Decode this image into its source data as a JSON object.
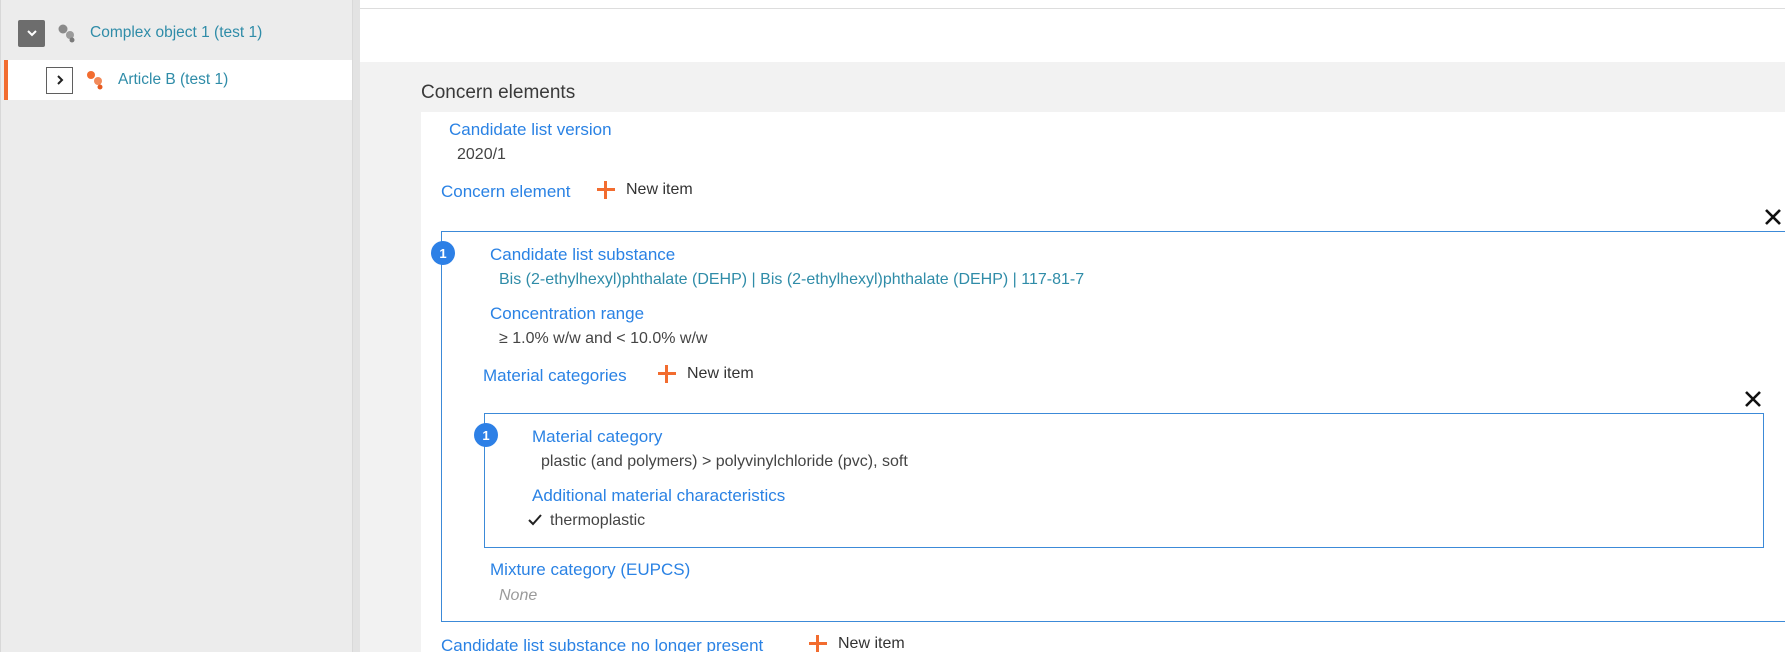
{
  "tree": {
    "root": {
      "label": "Complex object 1 (test 1)",
      "icon": "gear-cluster-icon",
      "toggle": "chevron-down-icon"
    },
    "child": {
      "label": "Article B (test 1)",
      "icon": "article-icon",
      "toggle": "chevron-right-icon"
    }
  },
  "section": {
    "title": "Concern elements"
  },
  "candidate_list_version": {
    "label": "Candidate list version",
    "value": "2020/1"
  },
  "concern_element": {
    "label": "Concern element",
    "new_item": "New item"
  },
  "concern_items": [
    {
      "index": "1",
      "candidate_substance": {
        "label": "Candidate list substance",
        "value": "Bis (2-ethylhexyl)phthalate (DEHP) | Bis (2-ethylhexyl)phthalate (DEHP) | 117-81-7"
      },
      "concentration_range": {
        "label": "Concentration range",
        "value": "≥ 1.0% w/w and < 10.0% w/w"
      },
      "material_categories": {
        "label": "Material categories",
        "new_item": "New item"
      },
      "material_items": [
        {
          "index": "1",
          "material_category": {
            "label": "Material category",
            "value": "plastic (and polymers) > polyvinylchloride (pvc), soft"
          },
          "additional_characteristics": {
            "label": "Additional material characteristics",
            "value": "thermoplastic"
          }
        }
      ],
      "mixture_category": {
        "label": "Mixture category (EUPCS)",
        "value": "None"
      }
    }
  ],
  "no_longer_present": {
    "label": "Candidate list substance no longer present",
    "new_item": "New item"
  },
  "colors": {
    "accent_blue": "#2a82e4",
    "accent_orange": "#f26c2f",
    "teal": "#2f8ca8"
  }
}
